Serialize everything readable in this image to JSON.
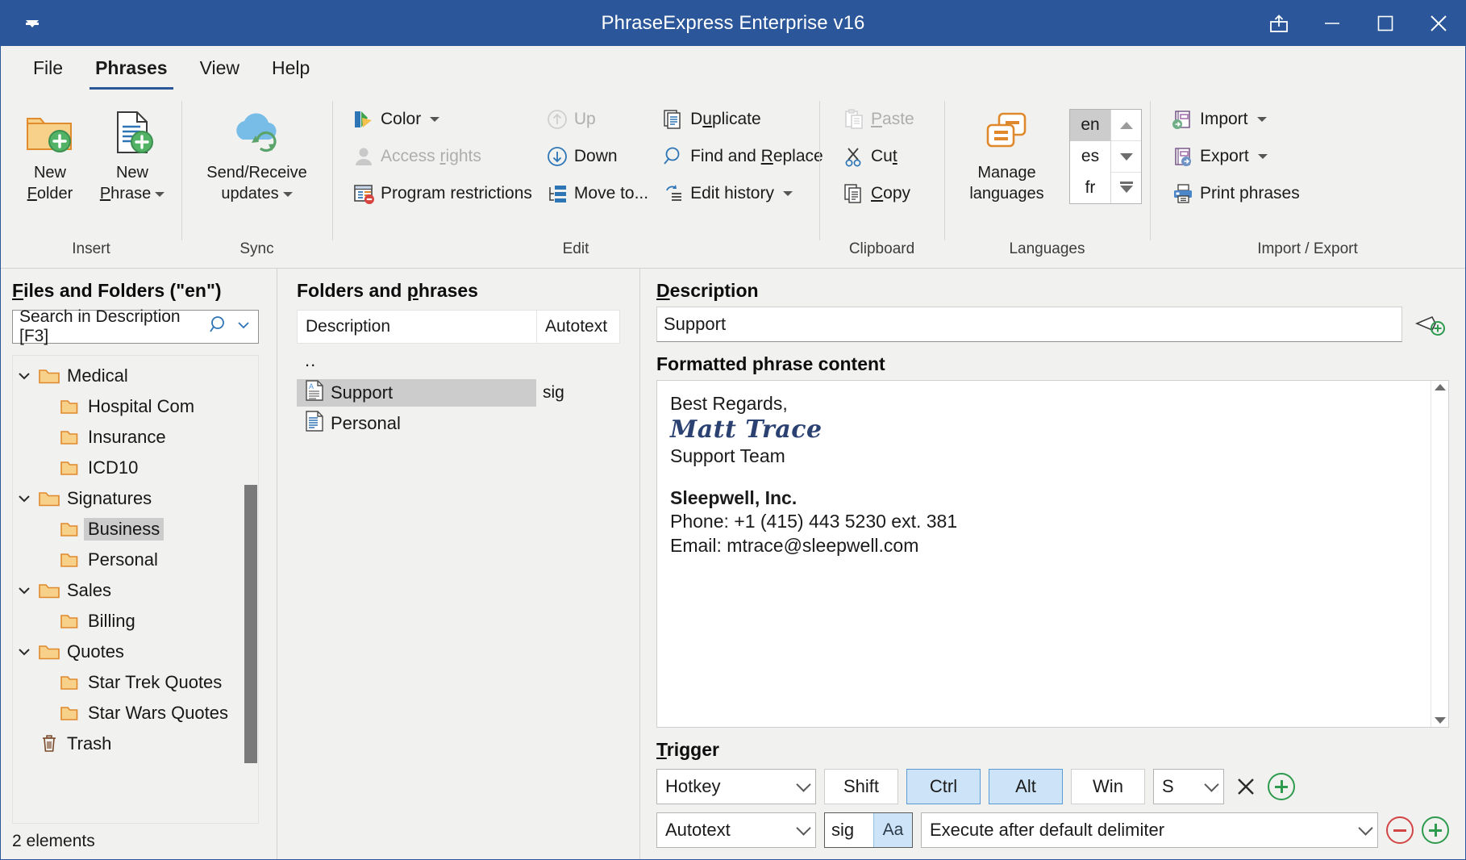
{
  "window": {
    "title": "PhraseExpress Enterprise v16",
    "quick_access_name": "quick-access-toolbar",
    "controls": {
      "share": "share",
      "minimize": "minimize",
      "maximize": "maximize",
      "close": "close"
    }
  },
  "menu": {
    "items": [
      {
        "label": "File",
        "active": false
      },
      {
        "label": "Phrases",
        "active": true
      },
      {
        "label": "View",
        "active": false
      },
      {
        "label": "Help",
        "active": false
      }
    ]
  },
  "ribbon": {
    "groups": [
      {
        "label": "Insert",
        "buttons": [
          {
            "label_line1": "New",
            "label_line2": "Folder",
            "accel": "F",
            "dropdown": false
          },
          {
            "label_line1": "New",
            "label_line2": "Phrase",
            "accel": "P",
            "dropdown": true
          }
        ]
      },
      {
        "label": "Sync",
        "buttons": [
          {
            "label_line1": "Send/Receive",
            "label_line2": "updates",
            "dropdown": true
          }
        ]
      },
      {
        "label": "Edit",
        "commands": [
          {
            "label": "Color",
            "dropdown": true,
            "disabled": false
          },
          {
            "label": "Access rights",
            "accel": "r",
            "disabled": true
          },
          {
            "label": "Program restrictions",
            "disabled": false
          },
          {
            "label": "Up",
            "disabled": true
          },
          {
            "label": "Down",
            "disabled": false
          },
          {
            "label": "Move to...",
            "disabled": false
          },
          {
            "label": "Duplicate",
            "accel": "u",
            "disabled": false
          },
          {
            "label": "Find and Replace",
            "accel": "R",
            "disabled": false
          },
          {
            "label": "Edit history",
            "dropdown": true,
            "disabled": false
          }
        ]
      },
      {
        "label": "Clipboard",
        "commands": [
          {
            "label": "Paste",
            "accel": "P",
            "disabled": true
          },
          {
            "label": "Cut",
            "accel": "t",
            "disabled": false
          },
          {
            "label": "Copy",
            "accel": "C",
            "disabled": false
          }
        ]
      },
      {
        "label": "Languages",
        "manage_label_line1": "Manage",
        "manage_label_line2": "languages",
        "language_list": [
          {
            "code": "en",
            "selected": true
          },
          {
            "code": "es",
            "selected": false
          },
          {
            "code": "fr",
            "selected": false
          }
        ]
      },
      {
        "label": "Import / Export",
        "commands": [
          {
            "label": "Import",
            "dropdown": true
          },
          {
            "label": "Export",
            "dropdown": true
          },
          {
            "label": "Print phrases",
            "dropdown": false
          }
        ]
      }
    ]
  },
  "left_pane": {
    "title_prefix": "F",
    "title": "Files and Folders (\"en\")",
    "search_placeholder": "Search in Description [F3]",
    "tree": [
      {
        "label": "Medical",
        "depth": 0,
        "type": "folder",
        "expanded": true,
        "selected": false
      },
      {
        "label": "Hospital Com",
        "depth": 1,
        "type": "folder",
        "expanded": null,
        "selected": false
      },
      {
        "label": "Insurance",
        "depth": 1,
        "type": "folder",
        "expanded": null,
        "selected": false
      },
      {
        "label": "ICD10",
        "depth": 1,
        "type": "folder",
        "expanded": null,
        "selected": false
      },
      {
        "label": "Signatures",
        "depth": 0,
        "type": "folder",
        "expanded": true,
        "selected": false
      },
      {
        "label": "Business",
        "depth": 1,
        "type": "folder",
        "expanded": null,
        "selected": true
      },
      {
        "label": "Personal",
        "depth": 1,
        "type": "folder",
        "expanded": null,
        "selected": false
      },
      {
        "label": "Sales",
        "depth": 0,
        "type": "folder",
        "expanded": true,
        "selected": false
      },
      {
        "label": "Billing",
        "depth": 1,
        "type": "folder",
        "expanded": null,
        "selected": false
      },
      {
        "label": "Quotes",
        "depth": 0,
        "type": "folder",
        "expanded": true,
        "selected": false
      },
      {
        "label": "Star Trek Quotes",
        "depth": 1,
        "type": "folder",
        "expanded": null,
        "selected": false
      },
      {
        "label": "Star Wars Quotes",
        "depth": 1,
        "type": "folder",
        "expanded": null,
        "selected": false
      },
      {
        "label": "Trash",
        "depth": 0,
        "type": "trash",
        "expanded": null,
        "selected": false
      }
    ],
    "status": "2 elements"
  },
  "mid_pane": {
    "title": "Folders and phrases",
    "title_accel": "p",
    "columns": [
      "Description",
      "Autotext"
    ],
    "parent_row": "..",
    "rows": [
      {
        "description": "Support",
        "autotext": "sig",
        "icon": "phrase-formatted-icon",
        "selected": true
      },
      {
        "description": "Personal",
        "autotext": "",
        "icon": "phrase-icon",
        "selected": false
      }
    ]
  },
  "right_pane": {
    "description_label": "Description",
    "description_value": "Support",
    "content_label": "Formatted phrase content",
    "content_lines": [
      {
        "text": "Best Regards,",
        "style": "normal"
      },
      {
        "text": "Matt Trace",
        "style": "signature"
      },
      {
        "text": "Support Team",
        "style": "normal"
      },
      {
        "text": "",
        "style": "blank"
      },
      {
        "text": "Sleepwell, Inc.",
        "style": "bold"
      },
      {
        "text": "Phone: +1 (415) 443 5230 ext. 381",
        "style": "normal"
      },
      {
        "text": "Email: mtrace@sleepwell.com",
        "style": "normal"
      }
    ],
    "trigger_label": "Trigger",
    "trigger_accel": "T",
    "row1": {
      "type": "Hotkey",
      "modifiers": [
        {
          "label": "Shift",
          "active": false
        },
        {
          "label": "Ctrl",
          "active": true
        },
        {
          "label": "Alt",
          "active": true
        },
        {
          "label": "Win",
          "active": false
        }
      ],
      "key": "S",
      "remove_icon": "close-icon",
      "add_icon": "add-icon"
    },
    "row2": {
      "type": "Autotext",
      "value": "sig",
      "case_icon": "Aa",
      "execution": "Execute after default delimiter",
      "remove_icon": "remove-icon",
      "add_icon": "add-icon"
    }
  },
  "colors": {
    "title_bar": "#2b579a",
    "accent": "#2b579a",
    "selection": "#cccccc",
    "active_toggle": "#cde3f7",
    "folder": "#f5c678",
    "folder_border": "#e08b2c",
    "signature_text": "#2b4172"
  }
}
